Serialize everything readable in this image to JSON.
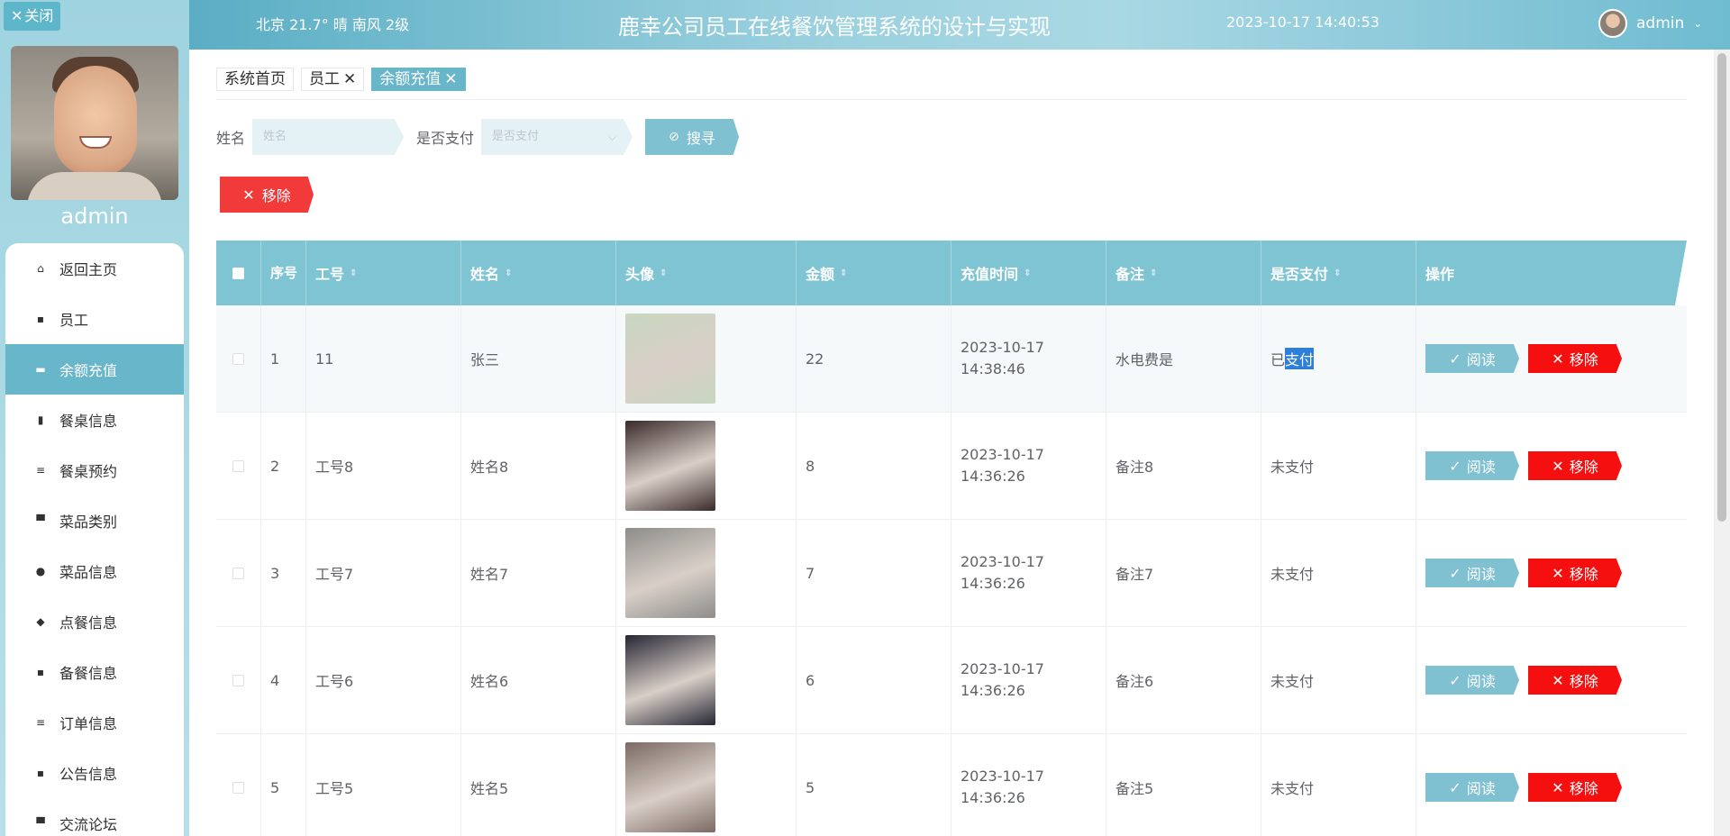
{
  "sidebar": {
    "close_label": "关闭",
    "admin_name": "admin",
    "items": [
      {
        "label": "返回主页",
        "icon": "home-icon",
        "glyph": "⌂"
      },
      {
        "label": "员工",
        "icon": "grid-icon",
        "glyph": "▪"
      },
      {
        "label": "余额充值",
        "icon": "chat-icon",
        "glyph": "▬"
      },
      {
        "label": "餐桌信息",
        "icon": "clipboard-icon",
        "glyph": "▮"
      },
      {
        "label": "餐桌预约",
        "icon": "list-icon",
        "glyph": "≡"
      },
      {
        "label": "菜品类别",
        "icon": "monitor-icon",
        "glyph": "▀"
      },
      {
        "label": "菜品信息",
        "icon": "pin-icon",
        "glyph": "●"
      },
      {
        "label": "点餐信息",
        "icon": "wallet-icon",
        "glyph": "◆"
      },
      {
        "label": "备餐信息",
        "icon": "grid-icon",
        "glyph": "▪"
      },
      {
        "label": "订单信息",
        "icon": "list-icon",
        "glyph": "≡"
      },
      {
        "label": "公告信息",
        "icon": "grid-icon",
        "glyph": "▪"
      },
      {
        "label": "交流论坛",
        "icon": "monitor-icon",
        "glyph": "▀"
      }
    ],
    "active_index": 2
  },
  "header": {
    "weather": "北京  21.7°  晴  南风  2级",
    "title": "鹿幸公司员工在线餐饮管理系统的设计与实现",
    "datetime": "2023-10-17 14:40:53",
    "user": "admin"
  },
  "tabs": [
    {
      "label": "系统首页",
      "closable": false,
      "active": false
    },
    {
      "label": "员工",
      "closable": true,
      "active": false
    },
    {
      "label": "余额充值",
      "closable": true,
      "active": true
    }
  ],
  "search": {
    "name_label": "姓名",
    "name_placeholder": "姓名",
    "paid_label": "是否支付",
    "paid_placeholder": "是否支付",
    "search_button": "搜寻"
  },
  "toolbar": {
    "remove_label": "移除"
  },
  "table": {
    "headers": [
      "序号",
      "工号",
      "姓名",
      "头像",
      "金额",
      "充值时间",
      "备注",
      "是否支付",
      "操作"
    ],
    "read_label": "阅读",
    "remove_label": "移除",
    "rows": [
      {
        "index": "1",
        "emp_no": "11",
        "name": "张三",
        "amount": "22",
        "time": "2023-10-17 14:38:46",
        "note": "水电费是",
        "paid_a": "已",
        "paid_b": "支付",
        "avatar": "#c8d6c0"
      },
      {
        "index": "2",
        "emp_no": "工号8",
        "name": "姓名8",
        "amount": "8",
        "time": "2023-10-17 14:36:26",
        "note": "备注8",
        "paid_a": "未支付",
        "paid_b": "",
        "avatar": "#3a2b2a"
      },
      {
        "index": "3",
        "emp_no": "工号7",
        "name": "姓名7",
        "amount": "7",
        "time": "2023-10-17 14:36:26",
        "note": "备注7",
        "paid_a": "未支付",
        "paid_b": "",
        "avatar": "#8d8d8a"
      },
      {
        "index": "4",
        "emp_no": "工号6",
        "name": "姓名6",
        "amount": "6",
        "time": "2023-10-17 14:36:26",
        "note": "备注6",
        "paid_a": "未支付",
        "paid_b": "",
        "avatar": "#262634"
      },
      {
        "index": "5",
        "emp_no": "工号5",
        "name": "姓名5",
        "amount": "5",
        "time": "2023-10-17 14:36:26",
        "note": "备注5",
        "paid_a": "未支付",
        "paid_b": "",
        "avatar": "#7c6a64"
      }
    ]
  }
}
